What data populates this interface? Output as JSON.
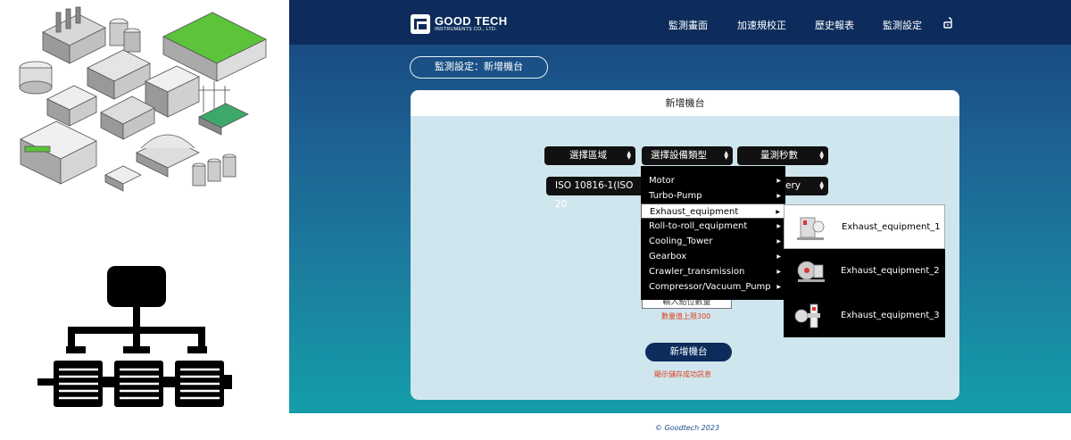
{
  "nav": {
    "logo_name": "GOOD TECH",
    "logo_sub": "INSTRUMENTS CO., LTD.",
    "items": [
      "監測畫面",
      "加速規校正",
      "歷史報表",
      "監測設定"
    ],
    "lock_icon": "unlock-icon"
  },
  "breadcrumb": "監測設定：新增機台",
  "card": {
    "title": "新增機台",
    "selects": {
      "area": "選擇區域",
      "equipment_type": "選擇設備類型",
      "measure_seconds": "量測秒數",
      "standard": "ISO 10816-1(ISO 20",
      "standard_tail": "ery"
    },
    "dropdown_items": [
      "Motor",
      "Turbo-Pump",
      "Exhaust_equipment",
      "Roll-to-roll_equipment",
      "Cooling_Tower",
      "Gearbox",
      "Crawler_transmission",
      "Compressor/Vacuum_Pump"
    ],
    "dropdown_active": "Exhaust_equipment",
    "submenu_items": [
      "Exhaust_equipment_1",
      "Exhaust_equipment_2",
      "Exhaust_equipment_3"
    ],
    "qty_input_value": "輸入點位數量",
    "qty_hint": "數量值上限300",
    "add_button": "新增機台",
    "save_message": "顯示儲存成功訊息"
  },
  "footer": "© Goodtech 2023",
  "colors": {
    "navbar": "#0d2c5c",
    "accent_red": "#e0401c",
    "card_bg": "#cfe6ee",
    "select_bg": "#111111"
  }
}
